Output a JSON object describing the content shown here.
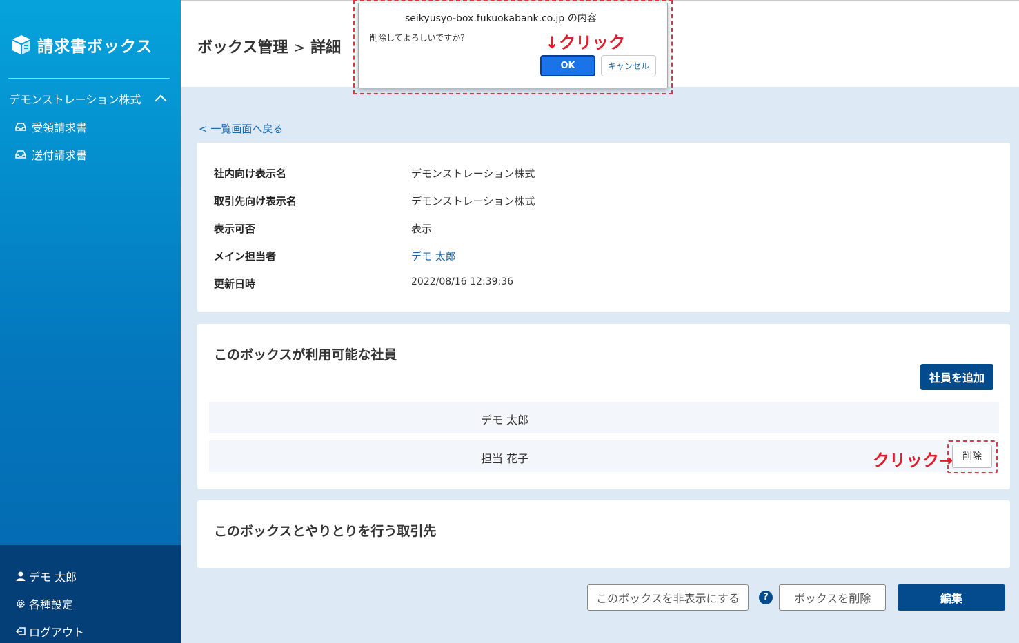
{
  "sidebar": {
    "logo_text": "請求書ボックス",
    "company": "デモンストレーション株式",
    "items": [
      {
        "label": "受領請求書",
        "icon": "inbox-icon"
      },
      {
        "label": "送付請求書",
        "icon": "inbox-icon"
      }
    ],
    "bottom": {
      "user": "デモ 太郎",
      "settings": "各種設定",
      "logout": "ログアウト"
    }
  },
  "header": {
    "title": "ボックス管理",
    "separator": ">",
    "subtitle": "詳細"
  },
  "back_link": "< 一覧画面へ戻る",
  "details": {
    "rows": [
      {
        "label": "社内向け表示名",
        "value": "デモンストレーション株式"
      },
      {
        "label": "取引先向け表示名",
        "value": "デモンストレーション株式"
      },
      {
        "label": "表示可否",
        "value": "表示"
      },
      {
        "label": "メイン担当者",
        "value": "デモ 太郎"
      },
      {
        "label": "更新日時",
        "value": "2022/08/16 12:39:36"
      }
    ]
  },
  "employees": {
    "title": "このボックスが利用可能な社員",
    "add_button": "社員を追加",
    "rows": [
      {
        "name": "デモ 太郎"
      },
      {
        "name": "担当 花子",
        "delete_label": "削除"
      }
    ],
    "annotation": "クリック→"
  },
  "partners": {
    "title": "このボックスとやりとりを行う取引先"
  },
  "footer": {
    "hide_button": "このボックスを非表示にする",
    "help": "?",
    "delete_box_button": "ボックスを削除",
    "edit_button": "編集"
  },
  "dialog": {
    "title": "seikyusyo-box.fukuokabank.co.jp の内容",
    "message": "削除してよろしいですか？",
    "ok": "OK",
    "cancel": "キャンセル",
    "annotation": "↓クリック"
  },
  "colors": {
    "primary": "#034b8c",
    "link": "#1a6bb5",
    "highlight": "#e0364a",
    "dialog_ok": "#1a73e8"
  }
}
